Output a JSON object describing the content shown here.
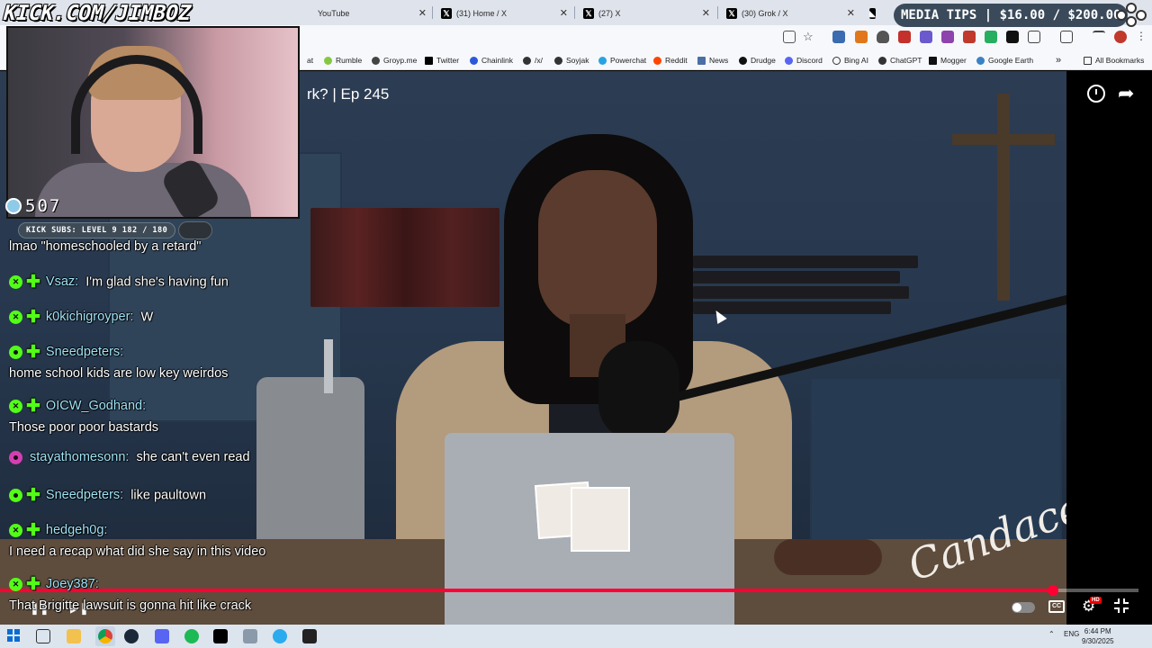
{
  "browser": {
    "tabs": [
      {
        "label": "YouTube",
        "icon": "youtube-icon"
      },
      {
        "label": "(31) Home / X",
        "icon": "x-logo-icon"
      },
      {
        "label": "(27) X",
        "icon": "x-logo-icon"
      },
      {
        "label": "(30) Grok / X",
        "icon": "x-logo-icon"
      }
    ],
    "bookmarks": [
      {
        "label": "at",
        "icon": "bookmark-icon"
      },
      {
        "label": "Rumble",
        "icon": "rumble-icon"
      },
      {
        "label": "Groyp.me",
        "icon": "groyp-icon"
      },
      {
        "label": "Twitter",
        "icon": "x-logo-icon"
      },
      {
        "label": "Chainlink",
        "icon": "chainlink-icon"
      },
      {
        "label": "/x/",
        "icon": "clover-icon"
      },
      {
        "label": "Soyjak",
        "icon": "soyjak-icon"
      },
      {
        "label": "Powerchat",
        "icon": "powerchat-icon"
      },
      {
        "label": "Reddit",
        "icon": "reddit-icon"
      },
      {
        "label": "News",
        "icon": "news-icon"
      },
      {
        "label": "Drudge",
        "icon": "drudge-icon"
      },
      {
        "label": "Discord",
        "icon": "discord-icon"
      },
      {
        "label": "Bing AI",
        "icon": "search-icon"
      },
      {
        "label": "ChatGPT",
        "icon": "chatgpt-icon"
      },
      {
        "label": "Mogger",
        "icon": "mogger-icon"
      },
      {
        "label": "Google Earth",
        "icon": "globe-icon"
      }
    ],
    "all_bookmarks_label": "All Bookmarks"
  },
  "overlay": {
    "brand": "KICK.COM/JIMBOZ",
    "viewer_count": "507",
    "kick_subs": "KICK SUBS: LEVEL 9 182 / 180",
    "media_tips": "MEDIA TIPS | $16.00 / $200.00"
  },
  "video": {
    "title": "rk? | Ep 245",
    "signature": "Candace",
    "progress": 0.925
  },
  "chat": [
    {
      "badges": [],
      "user": "",
      "text": "lmao \"homeschooled by a retard\"",
      "wrap": false
    },
    {
      "badges": [
        "x",
        "plus"
      ],
      "user": "Vsaz:",
      "text": "I'm glad she's having fun",
      "wrap": false
    },
    {
      "badges": [
        "x",
        "plus"
      ],
      "user": "k0kichigroyper:",
      "text": "W",
      "wrap": false
    },
    {
      "badges": [
        "dot",
        "plus"
      ],
      "user": "Sneedpeters:",
      "text": "home school kids are low key weirdos",
      "wrap": true
    },
    {
      "badges": [
        "x",
        "plus"
      ],
      "user": "OICW_Godhand:",
      "text": "Those poor poor bastards",
      "wrap": true
    },
    {
      "badges": [
        "pink"
      ],
      "user": "stayathomesonn:",
      "text": "she can't even read",
      "wrap": false
    },
    {
      "badges": [
        "dot",
        "plus"
      ],
      "user": "Sneedpeters:",
      "text": "like paultown",
      "wrap": false
    },
    {
      "badges": [
        "x",
        "plus"
      ],
      "user": "hedgeh0g:",
      "text": "I need a recap what did she say in this video",
      "wrap": true
    },
    {
      "badges": [
        "x",
        "plus"
      ],
      "user": "Joey387:",
      "text": "That Brigitte lawsuit is gonna hit like crack",
      "wrap": true
    }
  ],
  "taskbar": {
    "lang": "ENG",
    "time": "6:44 PM",
    "date": "9/30/2025"
  },
  "colors": {
    "kick_green": "#53fc18",
    "username_blue": "#9fe3f7",
    "progress_red": "#ff0033"
  }
}
